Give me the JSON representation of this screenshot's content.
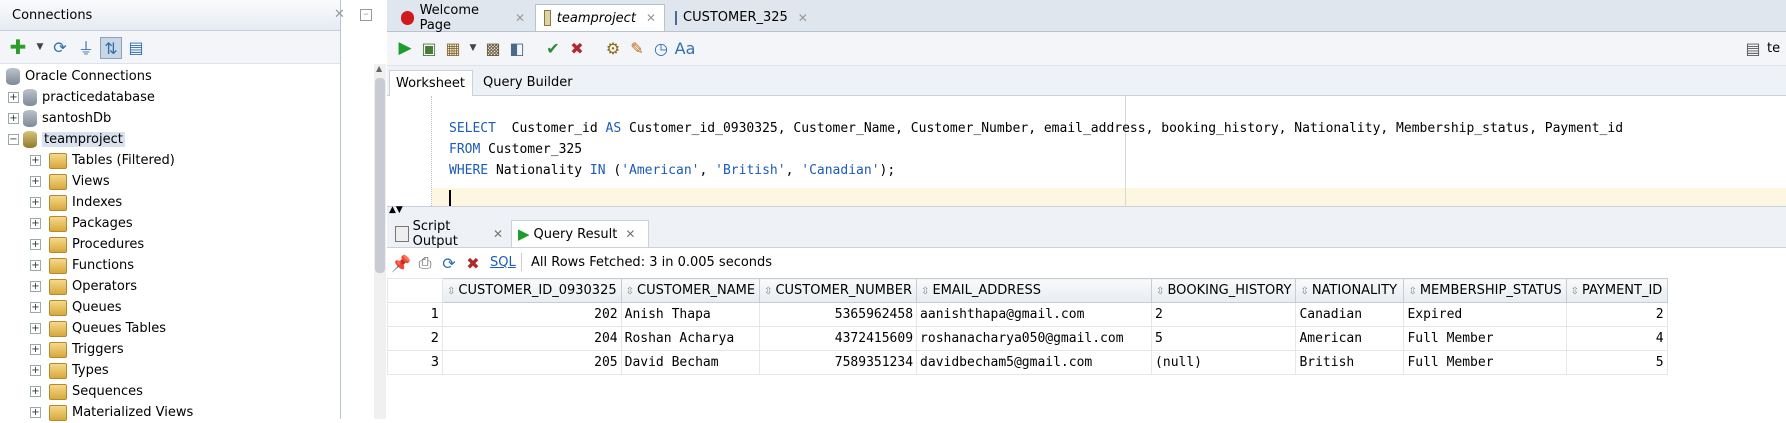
{
  "connections_panel": {
    "title": "Connections",
    "tree": [
      {
        "label": "Oracle Connections",
        "level": 0,
        "icon": "database-folder-icon",
        "expander": ""
      },
      {
        "label": "practicedatabase",
        "level": 1,
        "icon": "database-icon",
        "expander": "+"
      },
      {
        "label": "santoshDb",
        "level": 1,
        "icon": "database-icon",
        "expander": "+"
      },
      {
        "label": "teamproject",
        "level": 1,
        "icon": "connected-database-icon",
        "expander": "−"
      },
      {
        "label": "Tables (Filtered)",
        "level": 2,
        "icon": "tables-icon",
        "expander": "+"
      },
      {
        "label": "Views",
        "level": 2,
        "icon": "views-icon",
        "expander": "+"
      },
      {
        "label": "Indexes",
        "level": 2,
        "icon": "indexes-icon",
        "expander": "+"
      },
      {
        "label": "Packages",
        "level": 2,
        "icon": "packages-icon",
        "expander": "+"
      },
      {
        "label": "Procedures",
        "level": 2,
        "icon": "procedures-icon",
        "expander": "+"
      },
      {
        "label": "Functions",
        "level": 2,
        "icon": "functions-icon",
        "expander": "+"
      },
      {
        "label": "Operators",
        "level": 2,
        "icon": "operators-icon",
        "expander": "+"
      },
      {
        "label": "Queues",
        "level": 2,
        "icon": "queues-icon",
        "expander": "+"
      },
      {
        "label": "Queues Tables",
        "level": 2,
        "icon": "queues-tables-icon",
        "expander": "+"
      },
      {
        "label": "Triggers",
        "level": 2,
        "icon": "triggers-icon",
        "expander": "+"
      },
      {
        "label": "Types",
        "level": 2,
        "icon": "types-icon",
        "expander": "+"
      },
      {
        "label": "Sequences",
        "level": 2,
        "icon": "sequences-icon",
        "expander": "+"
      },
      {
        "label": "Materialized Views",
        "level": 2,
        "icon": "materialized-views-icon",
        "expander": "+"
      }
    ]
  },
  "document_tabs": [
    {
      "label": "Welcome Page",
      "icon": "oracle-icon"
    },
    {
      "label": "teamproject",
      "icon": "sql-worksheet-icon"
    },
    {
      "label": "CUSTOMER_325",
      "icon": "table-icon"
    }
  ],
  "connection_selector_label": "te",
  "worksheet_tabs": {
    "worksheet": "Worksheet",
    "query_builder": "Query Builder"
  },
  "editor": {
    "line1": {
      "kw1": "SELECT",
      "rest1": "  Customer_id ",
      "kw2": "AS",
      "rest2": " Customer_id_0930325, Customer_Name, Customer_Number, email_address, booking_history, Nationality, Membership_status, Payment_id"
    },
    "line2": {
      "kw": "FROM",
      "rest": " Customer_325"
    },
    "line3": {
      "kw1": "WHERE",
      "rest1": " Nationality ",
      "kw2": "IN",
      "rest2": " (",
      "s1": "'American'",
      "c1": ", ",
      "s2": "'British'",
      "c2": ", ",
      "s3": "'Canadian'",
      "end": ");"
    }
  },
  "result_tabs": {
    "script_output": "Script Output",
    "query_result": "Query Result"
  },
  "result_toolbar": {
    "sql_label": "SQL",
    "status": "All Rows Fetched: 3 in 0.005 seconds"
  },
  "result_table": {
    "columns": [
      "CUSTOMER_ID_0930325",
      "CUSTOMER_NAME",
      "CUSTOMER_NUMBER",
      "EMAIL_ADDRESS",
      "BOOKING_HISTORY",
      "NATIONALITY",
      "MEMBERSHIP_STATUS",
      "PAYMENT_ID"
    ],
    "rows": [
      {
        "n": "1",
        "id": "202",
        "name": "Anish Thapa",
        "number": "5365962458",
        "email": "aanishthapa@gmail.com",
        "booking": "2",
        "nationality": "Canadian",
        "status": "Expired",
        "payment": "2"
      },
      {
        "n": "2",
        "id": "204",
        "name": "Roshan Acharya",
        "number": "4372415609",
        "email": "roshanacharya050@gmail.com",
        "booking": "5",
        "nationality": "American",
        "status": "Full Member",
        "payment": "4"
      },
      {
        "n": "3",
        "id": "205",
        "name": "David Becham",
        "number": "7589351234",
        "email": "davidbecham5@gmail.com",
        "booking": "(null)",
        "nationality": "British",
        "status": "Full Member",
        "payment": "5"
      }
    ]
  },
  "colors": {
    "keyword": "#1c5bb8",
    "current_line": "#fdf7e2",
    "panel_bg": "#eef1f5"
  }
}
